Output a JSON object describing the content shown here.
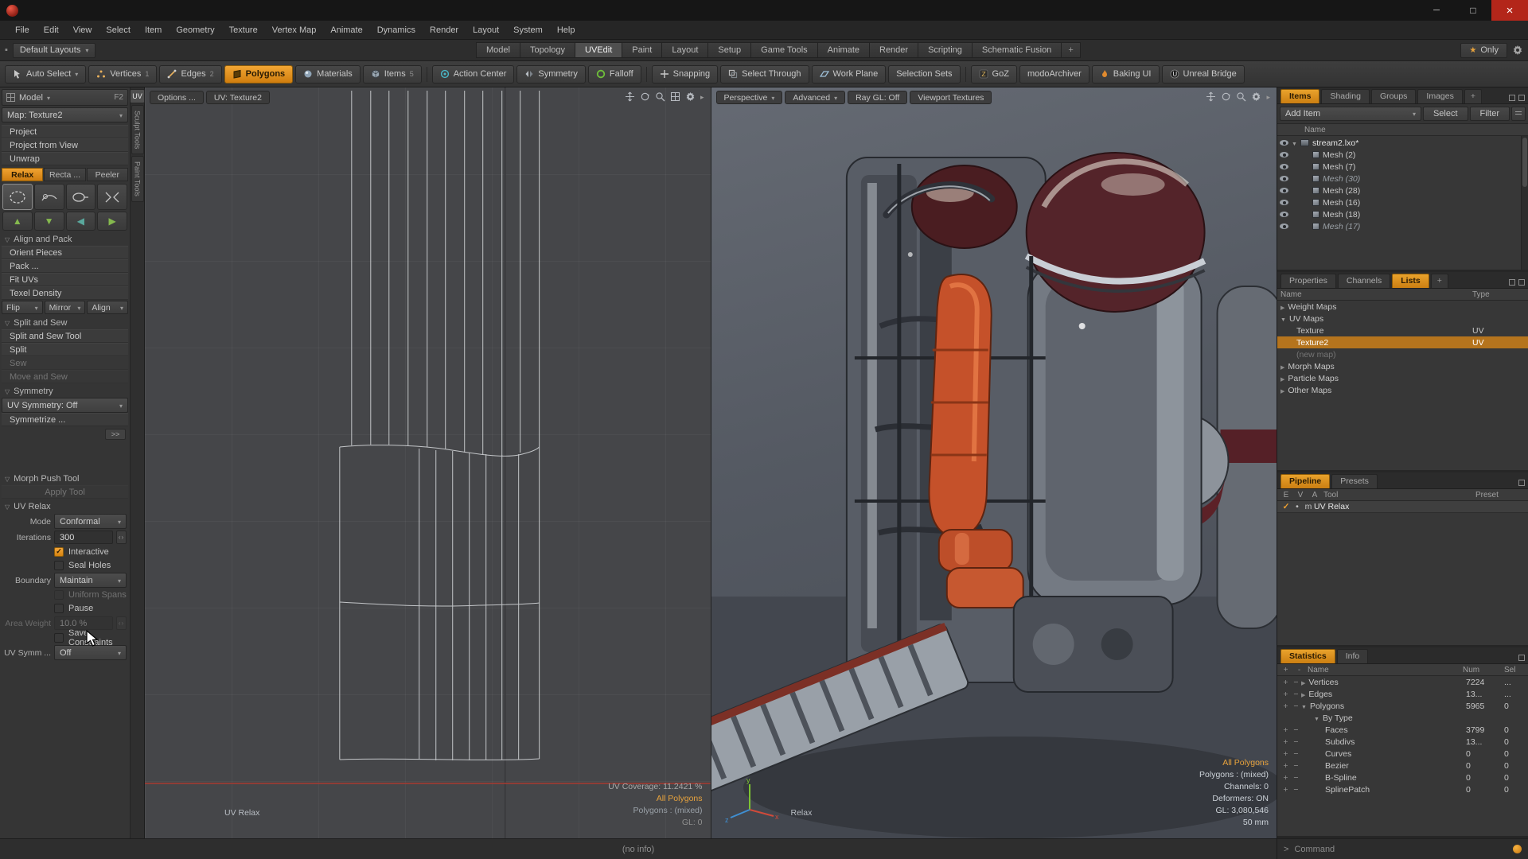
{
  "menubar": {
    "items": [
      "File",
      "Edit",
      "View",
      "Select",
      "Item",
      "Geometry",
      "Texture",
      "Vertex Map",
      "Animate",
      "Dynamics",
      "Render",
      "Layout",
      "System",
      "Help"
    ]
  },
  "layout_bar": {
    "selector": "Default Layouts",
    "tabs": [
      "Model",
      "Topology",
      "UVEdit",
      "Paint",
      "Layout",
      "Setup",
      "Game Tools",
      "Animate",
      "Render",
      "Scripting",
      "Schematic Fusion"
    ],
    "add_tab": "+",
    "only": "Only"
  },
  "toolbar": {
    "auto_select": "Auto Select",
    "vertices": "Vertices",
    "vertices_key": "1",
    "edges": "Edges",
    "edges_key": "2",
    "polygons": "Polygons",
    "materials": "Materials",
    "items": "Items",
    "items_key": "5",
    "action_center": "Action Center",
    "symmetry": "Symmetry",
    "falloff": "Falloff",
    "snapping": "Snapping",
    "select_through": "Select Through",
    "work_plane": "Work Plane",
    "selection_sets": "Selection Sets",
    "goz": "GoZ",
    "modo_archiver": "modoArchiver",
    "baking_ui": "Baking UI",
    "unreal_bridge": "Unreal Bridge"
  },
  "left_panel": {
    "title": "Model",
    "shortcut": "F2",
    "map": "Map: Texture2",
    "commands": [
      "Project",
      "Project from View",
      "Unwrap"
    ],
    "mode_tabs": [
      "Relax",
      "Recta ...",
      "Peeler"
    ],
    "align_title": "Align and Pack",
    "align_items": [
      "Orient Pieces",
      "Pack ...",
      "Fit UVs",
      "Texel Density"
    ],
    "flip": "Flip",
    "mirror": "Mirror",
    "align": "Align",
    "sew_title": "Split and Sew",
    "sew_items": [
      "Split and Sew Tool",
      "Split",
      "Sew",
      "Move and Sew"
    ],
    "symmetry_title": "Symmetry",
    "uv_symmetry": "UV Symmetry: Off",
    "symmetrize": "Symmetrize ...",
    "more": ">>",
    "morph_title": "Morph Push Tool",
    "apply_tool": "Apply Tool",
    "relax_title": "UV Relax",
    "mode_label": "Mode",
    "mode_value": "Conformal",
    "iterations_label": "Iterations",
    "iterations_value": "300",
    "interactive": "Interactive",
    "seal_holes": "Seal Holes",
    "boundary_label": "Boundary",
    "boundary_value": "Maintain",
    "uniform_spans": "Uniform Spans",
    "pause": "Pause",
    "area_label": "Area Weight",
    "area_value": "10.0 %",
    "save_constraints": "Save Constraints",
    "uv_symm_label": "UV Symm ...",
    "uv_symm_value": "Off",
    "side_tabs": [
      "UV",
      "Sculpt Tools",
      "Paint Tools"
    ]
  },
  "uv_view": {
    "tab_options": "Options ...",
    "tab_map": "UV: Texture2",
    "tool": "UV Relax",
    "coverage": "UV Coverage: 11.2421 %",
    "selection": "All Polygons",
    "polygons": "Polygons : (mixed)",
    "gl": "GL: 0"
  },
  "view3d": {
    "tab_perspective": "Perspective",
    "tab_advanced": "Advanced",
    "tab_raygl": "Ray GL: Off",
    "tab_textures": "Viewport Textures",
    "selection": "All Polygons",
    "polygons": "Polygons : (mixed)",
    "channels": "Channels: 0",
    "deformers": "Deformers: ON",
    "gl": "GL: 3,080,546",
    "grid_size": "50 mm",
    "tool": "Relax",
    "axis_x": "x",
    "axis_y": "y",
    "axis_z": "z"
  },
  "items_panel": {
    "tabs": [
      "Items",
      "Shading",
      "Groups",
      "Images"
    ],
    "add_tab": "+",
    "add_item": "Add Item",
    "select": "Select",
    "filter": "Filter",
    "name_col": "Name",
    "scene": "stream2.lxo*",
    "meshes": [
      "Mesh (2)",
      "Mesh (7)",
      "Mesh (30)",
      "Mesh (28)",
      "Mesh (16)",
      "Mesh (18)",
      "Mesh (17)"
    ]
  },
  "lists_panel": {
    "tabs": [
      "Properties",
      "Channels",
      "Lists"
    ],
    "add_tab": "+",
    "col_name": "Name",
    "col_type": "Type",
    "rows": [
      "Weight Maps",
      "UV Maps",
      "Texture",
      "Texture2",
      "(new map)",
      "Morph Maps",
      "Particle Maps",
      "Other Maps"
    ],
    "type_uv": "UV"
  },
  "pipeline_panel": {
    "tab_pipeline": "Pipeline",
    "tab_presets": "Presets",
    "col_e": "E",
    "col_v": "V",
    "col_a": "A",
    "col_tool": "Tool",
    "col_preset": "Preset",
    "row_mode": "m",
    "row_tool": "UV Relax"
  },
  "stats_panel": {
    "tab_statistics": "Statistics",
    "tab_info": "Info",
    "col_plus": "+",
    "col_minus": "-",
    "col_name": "Name",
    "col_num": "Num",
    "col_sel": "Sel",
    "rows": [
      [
        "Vertices",
        "7224",
        "..."
      ],
      [
        "Edges",
        "13...",
        "..."
      ],
      [
        "Polygons",
        "5965",
        "0"
      ],
      [
        "By Type",
        "",
        ""
      ],
      [
        "Faces",
        "3799",
        "0"
      ],
      [
        "Subdivs",
        "13...",
        "0"
      ],
      [
        "Curves",
        "0",
        "0"
      ],
      [
        "Bezier",
        "0",
        "0"
      ],
      [
        "B-Spline",
        "0",
        "0"
      ],
      [
        "SplinePatch",
        "0",
        "0"
      ]
    ]
  },
  "command": {
    "prompt": ">",
    "label": "Command"
  },
  "statusbar": {
    "info": "(no info)"
  }
}
